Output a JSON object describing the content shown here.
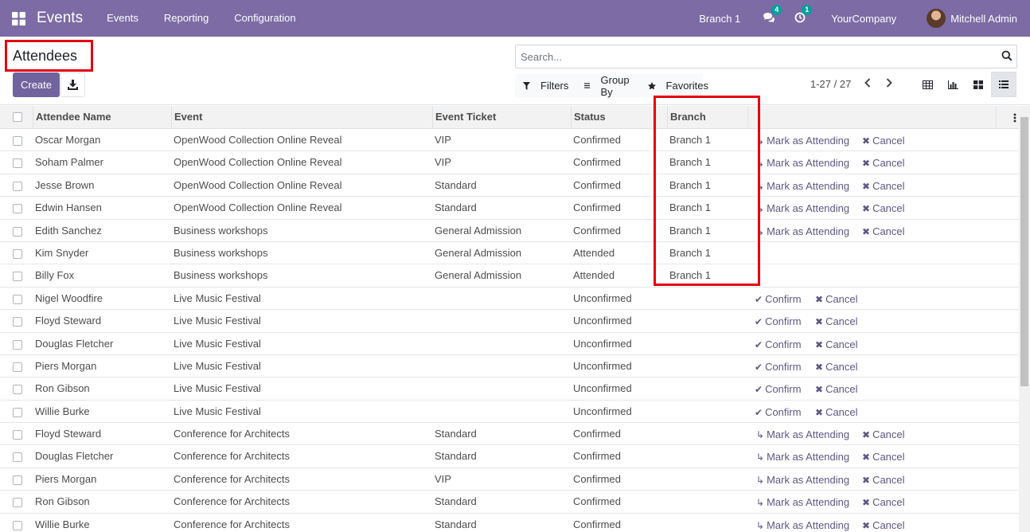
{
  "navbar": {
    "app_name": "Events",
    "menus": [
      "Events",
      "Reporting",
      "Configuration"
    ],
    "branch": "Branch 1",
    "messages_count": "4",
    "activities_count": "1",
    "company": "YourCompany",
    "user": "Mitchell Admin"
  },
  "control_panel": {
    "title": "Attendees",
    "create_label": "Create",
    "search_placeholder": "Search...",
    "filters_label": "Filters",
    "group_by_label": "Group By",
    "favorites_label": "Favorites",
    "pager": "1-27 / 27"
  },
  "table": {
    "columns": [
      "Attendee Name",
      "Event",
      "Event Ticket",
      "Status",
      "Branch"
    ],
    "rows": [
      {
        "name": "Oscar Morgan",
        "event": "OpenWood Collection Online Reveal",
        "ticket": "VIP",
        "status": "Confirmed",
        "branch": "Branch 1",
        "actions": [
          "Mark as Attending",
          "Cancel"
        ]
      },
      {
        "name": "Soham Palmer",
        "event": "OpenWood Collection Online Reveal",
        "ticket": "VIP",
        "status": "Confirmed",
        "branch": "Branch 1",
        "actions": [
          "Mark as Attending",
          "Cancel"
        ]
      },
      {
        "name": "Jesse Brown",
        "event": "OpenWood Collection Online Reveal",
        "ticket": "Standard",
        "status": "Confirmed",
        "branch": "Branch 1",
        "actions": [
          "Mark as Attending",
          "Cancel"
        ]
      },
      {
        "name": "Edwin Hansen",
        "event": "OpenWood Collection Online Reveal",
        "ticket": "Standard",
        "status": "Confirmed",
        "branch": "Branch 1",
        "actions": [
          "Mark as Attending",
          "Cancel"
        ]
      },
      {
        "name": "Edith Sanchez",
        "event": "Business workshops",
        "ticket": "General Admission",
        "status": "Confirmed",
        "branch": "Branch 1",
        "actions": [
          "Mark as Attending",
          "Cancel"
        ]
      },
      {
        "name": "Kim Snyder",
        "event": "Business workshops",
        "ticket": "General Admission",
        "status": "Attended",
        "branch": "Branch 1",
        "actions": []
      },
      {
        "name": "Billy Fox",
        "event": "Business workshops",
        "ticket": "General Admission",
        "status": "Attended",
        "branch": "Branch 1",
        "actions": []
      },
      {
        "name": "Nigel Woodfire",
        "event": "Live Music Festival",
        "ticket": "",
        "status": "Unconfirmed",
        "branch": "",
        "actions": [
          "Confirm",
          "Cancel"
        ]
      },
      {
        "name": "Floyd Steward",
        "event": "Live Music Festival",
        "ticket": "",
        "status": "Unconfirmed",
        "branch": "",
        "actions": [
          "Confirm",
          "Cancel"
        ]
      },
      {
        "name": "Douglas Fletcher",
        "event": "Live Music Festival",
        "ticket": "",
        "status": "Unconfirmed",
        "branch": "",
        "actions": [
          "Confirm",
          "Cancel"
        ]
      },
      {
        "name": "Piers Morgan",
        "event": "Live Music Festival",
        "ticket": "",
        "status": "Unconfirmed",
        "branch": "",
        "actions": [
          "Confirm",
          "Cancel"
        ]
      },
      {
        "name": "Ron Gibson",
        "event": "Live Music Festival",
        "ticket": "",
        "status": "Unconfirmed",
        "branch": "",
        "actions": [
          "Confirm",
          "Cancel"
        ]
      },
      {
        "name": "Willie Burke",
        "event": "Live Music Festival",
        "ticket": "",
        "status": "Unconfirmed",
        "branch": "",
        "actions": [
          "Confirm",
          "Cancel"
        ]
      },
      {
        "name": "Floyd Steward",
        "event": "Conference for Architects",
        "ticket": "Standard",
        "status": "Confirmed",
        "branch": "",
        "actions": [
          "Mark as Attending",
          "Cancel"
        ]
      },
      {
        "name": "Douglas Fletcher",
        "event": "Conference for Architects",
        "ticket": "Standard",
        "status": "Confirmed",
        "branch": "",
        "actions": [
          "Mark as Attending",
          "Cancel"
        ]
      },
      {
        "name": "Piers Morgan",
        "event": "Conference for Architects",
        "ticket": "VIP",
        "status": "Confirmed",
        "branch": "",
        "actions": [
          "Mark as Attending",
          "Cancel"
        ]
      },
      {
        "name": "Ron Gibson",
        "event": "Conference for Architects",
        "ticket": "Standard",
        "status": "Confirmed",
        "branch": "",
        "actions": [
          "Mark as Attending",
          "Cancel"
        ]
      },
      {
        "name": "Willie Burke",
        "event": "Conference for Architects",
        "ticket": "Standard",
        "status": "Confirmed",
        "branch": "",
        "actions": [
          "Mark as Attending",
          "Cancel"
        ]
      }
    ]
  },
  "colors": {
    "navbar": "#7c6ba5",
    "primary_button": "#71639e",
    "action_link": "#5f5682",
    "highlight_box": "#e4000f",
    "badge": "#00a09d"
  }
}
